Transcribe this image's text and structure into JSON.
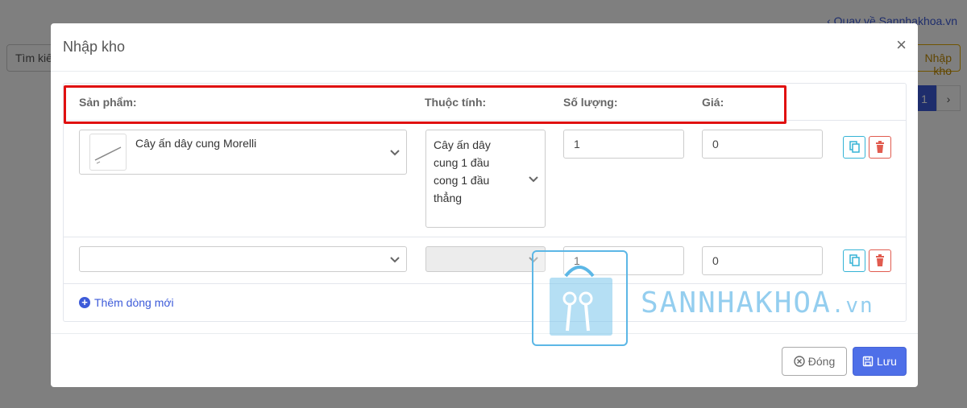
{
  "background": {
    "back_link": "Quay về Sannhakhoa.vn",
    "search_button": "Tìm kiếm",
    "import_button": "Nhập kho",
    "pager": {
      "prev": "‹",
      "current": "1",
      "next": "›"
    }
  },
  "modal": {
    "title": "Nhập kho",
    "close_glyph": "×",
    "columns": {
      "product": "Sản phẩm:",
      "attribute": "Thuộc tính:",
      "quantity": "Số lượng:",
      "price": "Giá:"
    },
    "rows": [
      {
        "product": "Cây ấn dây cung Morelli",
        "attribute_lines": [
          "Cây ấn dây",
          "cung 1 đầu",
          "cong 1 đầu",
          "thẳng"
        ],
        "quantity": "1",
        "price": "0"
      },
      {
        "product": "",
        "attribute_lines": [],
        "quantity": "1",
        "price": "0"
      }
    ],
    "add_row_label": "Thêm dòng mới",
    "footer": {
      "close_label": "Đóng",
      "save_label": "Lưu"
    }
  },
  "watermark": {
    "text": "SANNHAKHOA",
    "suffix": ".vn"
  },
  "colors": {
    "primary": "#4e6fe8",
    "danger": "#e15b4f",
    "info": "#35b3d6",
    "highlight": "#e01010"
  }
}
